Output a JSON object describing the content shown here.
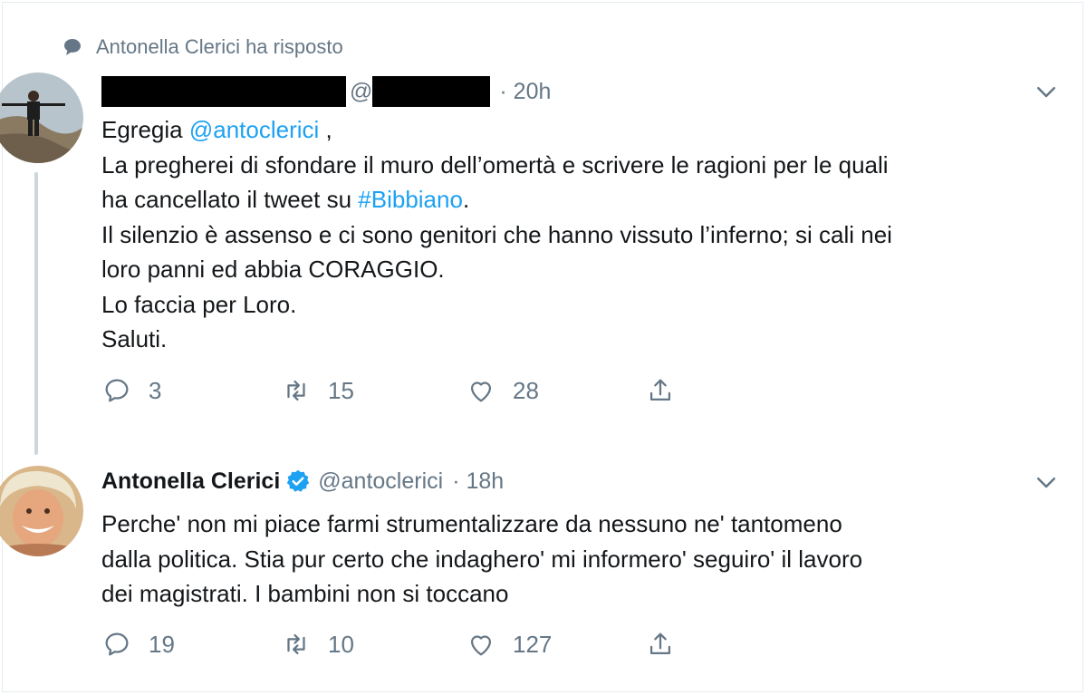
{
  "context": {
    "label": "Antonella Clerici ha risposto"
  },
  "tweet1": {
    "handle_prefix": "@",
    "time": "· 20h",
    "lines": {
      "l1_text": "Egregia ",
      "l1_mention": "@antoclerici",
      "l1_tail": " ,",
      "l2": "La pregherei di sfondare il muro dell’omertà e scrivere le ragioni per le quali",
      "l3_text": "ha cancellato il tweet su ",
      "l3_hashtag": "#Bibbiano",
      "l3_tail": ".",
      "l4": "Il silenzio è assenso e ci sono genitori che hanno vissuto l’inferno; si cali nei",
      "l5": "loro panni ed abbia CORAGGIO.",
      "l6": "Lo faccia per Loro.",
      "l7": "Saluti."
    },
    "replies": "3",
    "retweets": "15",
    "likes": "28"
  },
  "tweet2": {
    "name": "Antonella Clerici",
    "handle": "@antoclerici",
    "time": "· 18h",
    "lines": {
      "l1": "Perche' non mi piace farmi strumentalizzare da nessuno ne' tantomeno",
      "l2": "dalla politica. Stia pur certo che indaghero' mi informero' seguiro' il lavoro",
      "l3": "dei magistrati. I bambini non si toccano"
    },
    "replies": "19",
    "retweets": "10",
    "likes": "127"
  },
  "icons": {
    "context": "speech-bubble-icon",
    "reply": "reply-icon",
    "retweet": "retweet-icon",
    "like": "heart-icon",
    "share": "share-icon",
    "verified": "verified-badge-icon",
    "more": "chevron-down-icon"
  },
  "colors": {
    "link": "#1da1f2",
    "muted": "#657786",
    "text": "#14171a",
    "verified": "#1da1f2"
  }
}
